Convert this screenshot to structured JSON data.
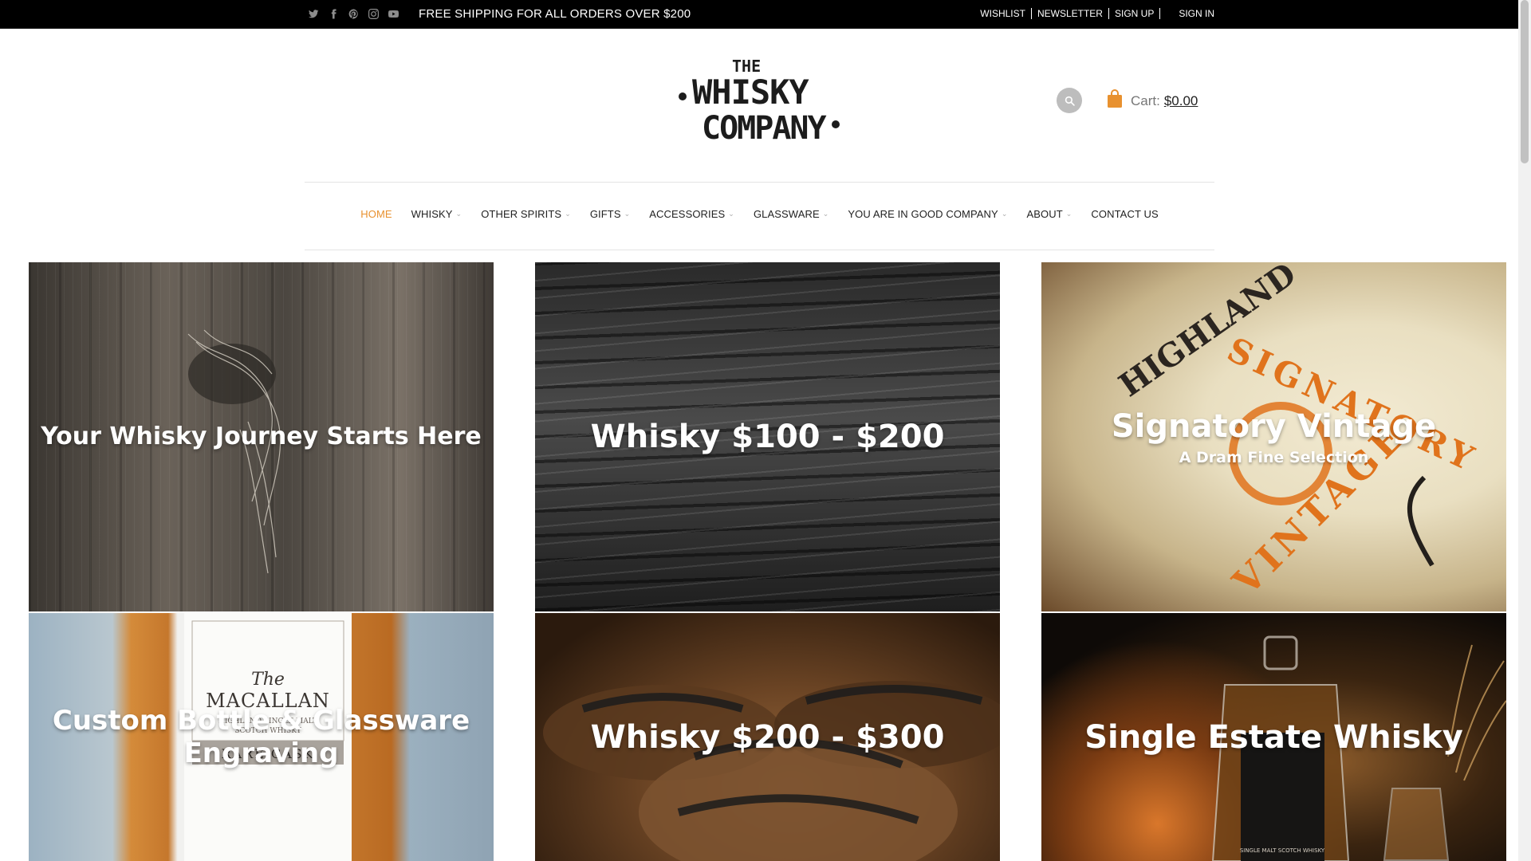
{
  "topbar": {
    "social": [
      {
        "name": "twitter-icon"
      },
      {
        "name": "facebook-icon"
      },
      {
        "name": "pinterest-icon"
      },
      {
        "name": "instagram-icon"
      },
      {
        "name": "youtube-icon"
      }
    ],
    "promo": "FREE SHIPPING FOR ALL ORDERS OVER $200",
    "links": {
      "wishlist": "WISHLIST",
      "newsletter": "NEWSLETTER",
      "signup": "SIGN UP",
      "signin": "SIGN IN"
    }
  },
  "header": {
    "logo": {
      "line1": "THE",
      "line2": "WHISKY",
      "line3": "COMPANY"
    },
    "cart": {
      "label": "Cart:",
      "value": "$0.00"
    }
  },
  "nav": {
    "items": [
      {
        "label": "HOME",
        "active": true,
        "dropdown": false
      },
      {
        "label": "WHISKY",
        "active": false,
        "dropdown": true
      },
      {
        "label": "OTHER SPIRITS",
        "active": false,
        "dropdown": true
      },
      {
        "label": "GIFTS",
        "active": false,
        "dropdown": true
      },
      {
        "label": "ACCESSORIES",
        "active": false,
        "dropdown": true
      },
      {
        "label": "GLASSWARE",
        "active": false,
        "dropdown": true
      },
      {
        "label": "YOU ARE IN GOOD COMPANY",
        "active": false,
        "dropdown": true
      },
      {
        "label": "ABOUT",
        "active": false,
        "dropdown": true
      },
      {
        "label": "CONTACT US",
        "active": false,
        "dropdown": false
      }
    ]
  },
  "tiles": {
    "t1": {
      "title": "Your Whisky Journey Starts Here"
    },
    "t2": {
      "title": "Whisky $100 - $200"
    },
    "t3": {
      "title": "Signatory Vintage",
      "subtitle": "A Dram Fine Selection",
      "label_text": "HIGHLAND",
      "label_text2": "SIGNATORY",
      "label_text3": "VINTAGE"
    },
    "t4": {
      "title_line1": "Custom Bottle & Glassware",
      "title_line2": "Engraving",
      "label_brand": "The",
      "label_brand2": "MACALLAN",
      "label_sub": "HIGHLAND SINGLE MALT",
      "label_sub2": "SCOTCH WHISKY",
      "label_cask": "RARE CASK"
    },
    "t5": {
      "title": "Whisky $200 - $300"
    },
    "t6": {
      "title": "Single Estate Whisky",
      "label_text": "SINGLE MALT SCOTCH WHISKY"
    }
  },
  "colors": {
    "accent": "#e8912f",
    "topbar": "#000000",
    "cart_icon": "#e8912f"
  }
}
